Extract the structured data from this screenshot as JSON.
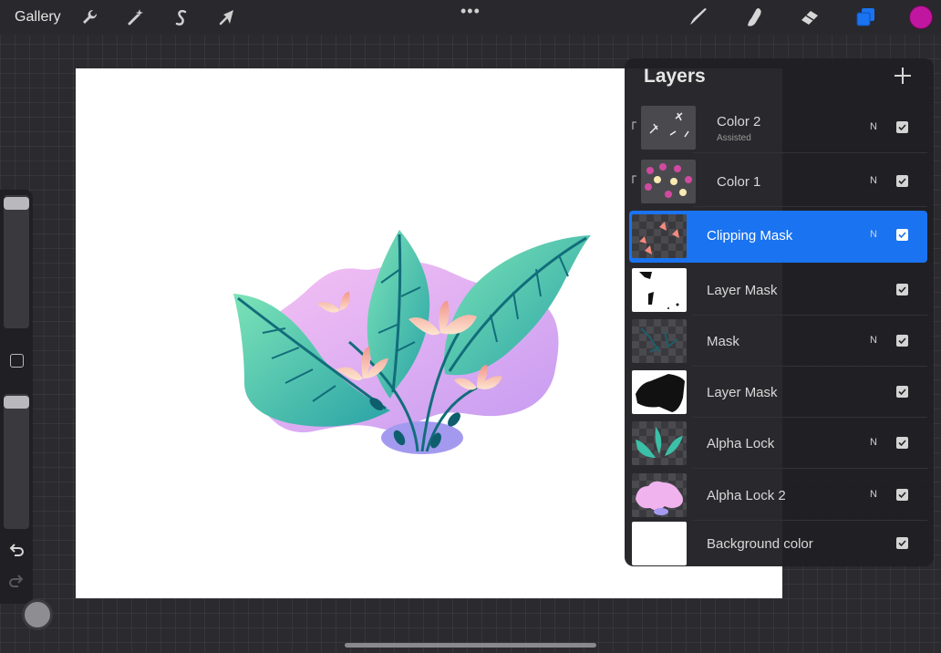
{
  "toolbar": {
    "gallery_label": "Gallery",
    "more_label": "•••",
    "left_tools": [
      "wrench-icon",
      "magic-wand-icon",
      "selection-s-icon",
      "transform-arrow-icon"
    ],
    "right_tools": [
      "brush-icon",
      "smudge-icon",
      "eraser-icon",
      "layers-icon"
    ],
    "accent": "#1a73f0",
    "current_color": "#c1169f"
  },
  "layers_panel": {
    "title": "Layers",
    "add_label": "+",
    "layers": [
      {
        "name": "Color 2",
        "sub": "Assisted",
        "blend": "N",
        "visible": true,
        "clipped": true
      },
      {
        "name": "Color 1",
        "sub": "",
        "blend": "N",
        "visible": true,
        "clipped": true
      },
      {
        "name": "Clipping Mask",
        "sub": "",
        "blend": "N",
        "visible": true,
        "selected": true
      },
      {
        "name": "Layer Mask",
        "sub": "",
        "blend": "",
        "visible": true
      },
      {
        "name": "Mask",
        "sub": "",
        "blend": "N",
        "visible": true
      },
      {
        "name": "Layer Mask",
        "sub": "",
        "blend": "",
        "visible": true
      },
      {
        "name": "Alpha Lock",
        "sub": "",
        "blend": "N",
        "visible": true
      },
      {
        "name": "Alpha Lock 2",
        "sub": "",
        "blend": "N",
        "visible": true
      },
      {
        "name": "Background color",
        "sub": "",
        "blend": "",
        "visible": true
      }
    ]
  },
  "sidebar": {
    "tools": [
      "brush-size-slider",
      "modify-button-icon",
      "opacity-slider",
      "undo-icon",
      "redo-icon"
    ]
  }
}
